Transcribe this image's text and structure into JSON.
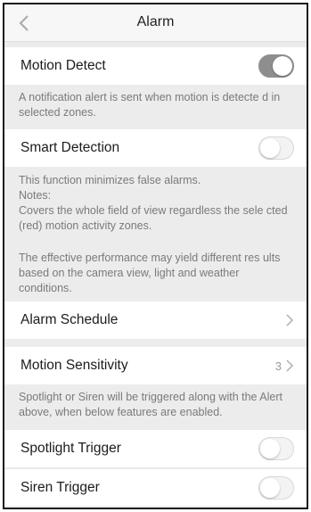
{
  "header": {
    "title": "Alarm"
  },
  "motion_detect": {
    "label": "Motion Detect",
    "enabled": true,
    "note": "A notification alert is sent when motion is detecte d in selected zones."
  },
  "smart_detection": {
    "label": "Smart Detection",
    "enabled": false,
    "note_line1": "This function minimizes false alarms.",
    "note_line2": "Notes:",
    "note_line3": "Covers the whole field of view regardless the sele cted (red) motion activity zones.",
    "note_line4": "The effective performance may yield different res ults based on the camera view, light and weather conditions."
  },
  "alarm_schedule": {
    "label": "Alarm Schedule"
  },
  "motion_sensitivity": {
    "label": "Motion Sensitivity",
    "value": "3",
    "note": "Spotlight or Siren will be triggered along with the Alert above, when below features are enabled."
  },
  "spotlight_trigger": {
    "label": "Spotlight Trigger",
    "enabled": false
  },
  "siren_trigger": {
    "label": "Siren Trigger",
    "enabled": false
  },
  "icons": {
    "back": "chevron-left-icon",
    "forward": "chevron-right-icon"
  }
}
